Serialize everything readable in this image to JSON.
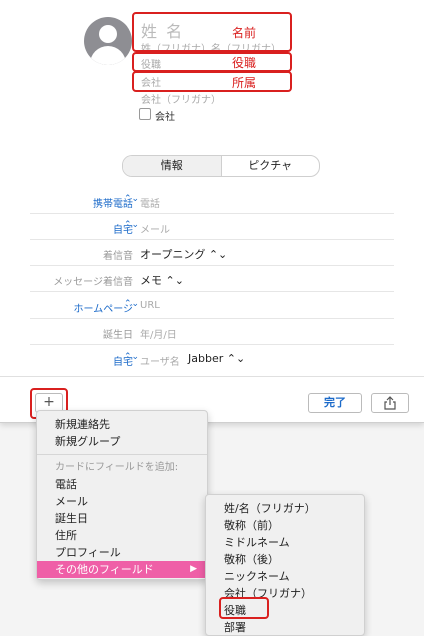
{
  "header": {
    "name_placeholder": "姓 名",
    "name_kana_placeholder": "姓（フリガナ）名（フリガナ）",
    "title_placeholder": "役職",
    "company_placeholder": "会社",
    "company_kana_placeholder": "会社（フリガナ）",
    "company_checkbox_label": "会社",
    "annotations": {
      "name": "名前",
      "title": "役職",
      "company": "所属"
    },
    "annotation_color": "#d9201f"
  },
  "segmented": {
    "info": "情報",
    "picture": "ピクチャ"
  },
  "fields": [
    {
      "label": "携帯電話",
      "value": "電話",
      "label_blue": true,
      "has_chevron": true
    },
    {
      "label": "自宅",
      "value": "メール",
      "label_blue": true,
      "has_chevron": true
    },
    {
      "label": "着信音",
      "value": "オープニング ⌃⌄",
      "label_blue": false,
      "has_chevron": false
    },
    {
      "label": "メッセージ着信音",
      "value": "メモ ⌃⌄",
      "label_blue": false,
      "has_chevron": false
    },
    {
      "label": "ホームページ",
      "value": "URL",
      "label_blue": true,
      "has_chevron": true
    },
    {
      "label": "誕生日",
      "value": "年/月/日",
      "label_blue": false,
      "has_chevron": false
    },
    {
      "label": "自宅",
      "value_placeholder": "ユーザ名",
      "value": "Jabber ⌃⌄",
      "label_blue": true,
      "has_chevron": true
    }
  ],
  "buttons": {
    "add": "+",
    "done": "完了",
    "share_icon": "share-icon"
  },
  "menu": {
    "items_top": [
      "新規連絡先",
      "新規グループ"
    ],
    "add_field_header": "カードにフィールドを追加:",
    "field_items": [
      "電話",
      "メール",
      "誕生日",
      "住所",
      "プロフィール"
    ],
    "other_fields": "その他のフィールド",
    "highlight_color": "#ef5fa7"
  },
  "submenu": {
    "items": [
      "姓/名（フリガナ）",
      "敬称（前）",
      "ミドルネーム",
      "敬称（後）",
      "ニックネーム",
      "会社（フリガナ）",
      "役職",
      "部署"
    ]
  },
  "accent_color": "#1b6ac9"
}
